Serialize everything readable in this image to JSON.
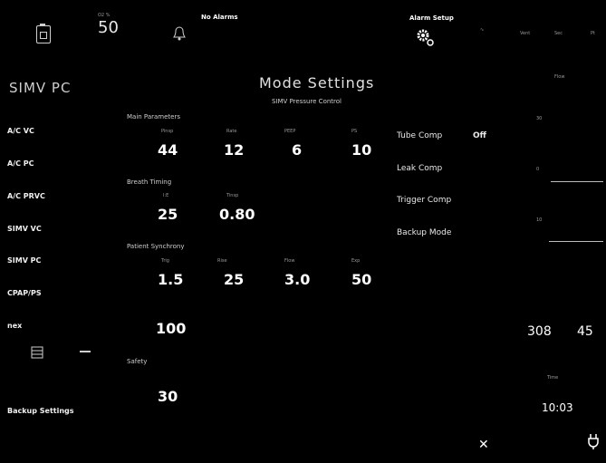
{
  "topbar": {
    "battery_icon": "battery-icon",
    "o2_value": "50",
    "o2_caption": "O2 %",
    "alarm_bell_icon": "bell-icon",
    "alarms_status": "No Alarms",
    "alarm_setup_label": "Alarm Setup",
    "gear_icon": "gear-icon",
    "flow_icon": "flow-icon",
    "right_dim_labels": [
      "Vent",
      "Sec",
      "Pt"
    ]
  },
  "sidebar": {
    "title": "SIMV PC",
    "items": [
      {
        "label": "A/C VC"
      },
      {
        "label": "A/C PC"
      },
      {
        "label": "A/C PRVC"
      },
      {
        "label": "SIMV VC"
      },
      {
        "label": "SIMV PC"
      },
      {
        "label": "CPAP/PS"
      },
      {
        "label": "nex"
      }
    ],
    "backup_settings_label": "Backup Settings"
  },
  "main": {
    "title": "Mode Settings",
    "subtitle": "SIMV Pressure Control",
    "sections": {
      "main_params": {
        "label": "Main Parameters",
        "values": [
          "44",
          "12",
          "6",
          "10"
        ],
        "captions": [
          "Pinsp",
          "Rate",
          "PEEP",
          "PS"
        ]
      },
      "breath_timing": {
        "label": "Breath Timing",
        "values": [
          "25",
          "0.80"
        ],
        "captions": [
          "I:E",
          "Tinsp"
        ]
      },
      "patient_sync": {
        "label": "Patient Synchrony",
        "values": [
          "1.5",
          "25",
          "3.0",
          "50"
        ],
        "captions": [
          "Trig",
          "Rise",
          "Flow",
          "Exp"
        ],
        "extra_value": "100"
      },
      "safety": {
        "label": "Safety",
        "values": [
          "30"
        ]
      }
    }
  },
  "options": {
    "tube_comp_label": "Tube Comp",
    "tube_comp_value": "Off",
    "leak_comp_label": "Leak Comp",
    "trigger_comp_label": "Trigger Comp",
    "backup_mode_label": "Backup Mode"
  },
  "right_panel": {
    "waveform_title": "Flow",
    "scale_top": "30",
    "scale_mid": "0",
    "scale_low": "10",
    "reading_1": "308",
    "reading_2": "45",
    "clock_caption": "Time",
    "clock": "10:03"
  },
  "footer": {
    "close_icon": "close-icon",
    "plug_icon": "plug-icon"
  }
}
